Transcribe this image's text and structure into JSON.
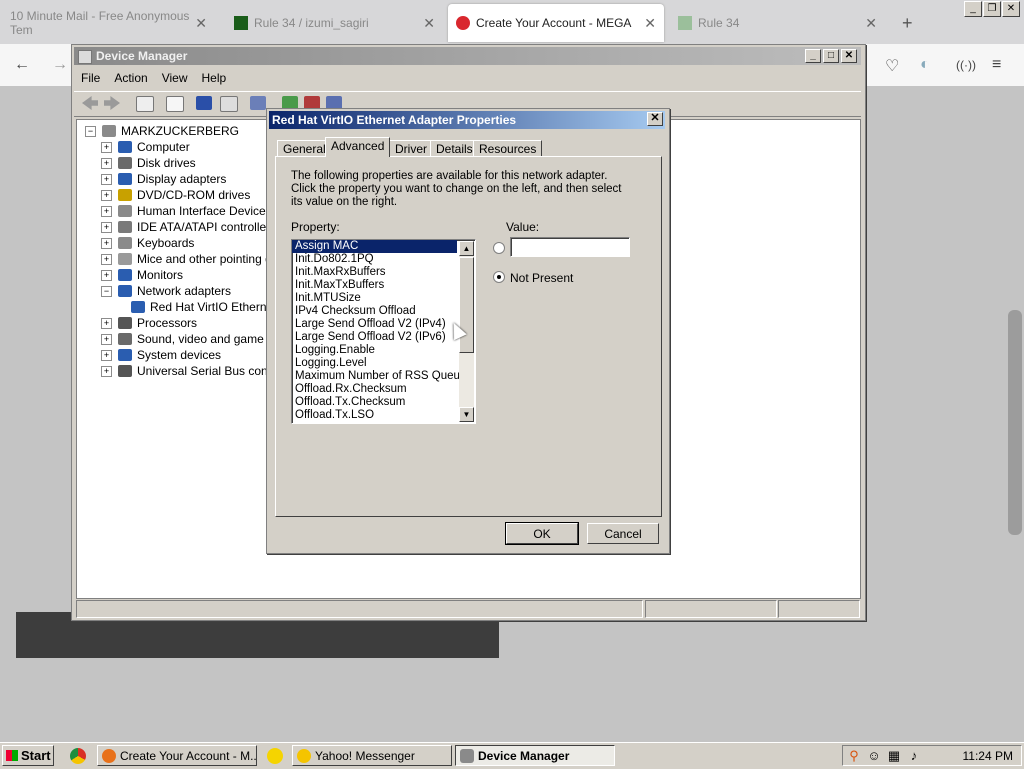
{
  "browser": {
    "tabs": [
      {
        "title": "10 Minute Mail - Free Anonymous Tem",
        "active": false
      },
      {
        "title": "Rule 34 / izumi_sagiri",
        "active": false
      },
      {
        "title": "Create Your Account - MEGA",
        "active": true
      },
      {
        "title": "Rule 34",
        "active": false
      }
    ],
    "new_tab": "+",
    "close_glyph": "✕"
  },
  "device_manager": {
    "title": "Device Manager",
    "menu": [
      "File",
      "Action",
      "View",
      "Help"
    ],
    "root": "MARKZUCKERBERG",
    "categories": [
      {
        "label": "Computer",
        "icon": "computer-icon",
        "color": "#2a5db0"
      },
      {
        "label": "Disk drives",
        "icon": "disk-icon",
        "color": "#6a6a6a"
      },
      {
        "label": "Display adapters",
        "icon": "display-icon",
        "color": "#2a5db0"
      },
      {
        "label": "DVD/CD-ROM drives",
        "icon": "dvd-icon",
        "color": "#c8a100"
      },
      {
        "label": "Human Interface Devices",
        "icon": "hid-icon",
        "color": "#8a8a8a"
      },
      {
        "label": "IDE ATA/ATAPI controllers",
        "icon": "ide-icon",
        "color": "#7a7a7a"
      },
      {
        "label": "Keyboards",
        "icon": "keyboard-icon",
        "color": "#8a8a8a"
      },
      {
        "label": "Mice and other pointing de",
        "icon": "mouse-icon",
        "color": "#9a9a9a"
      },
      {
        "label": "Monitors",
        "icon": "monitor-icon",
        "color": "#2a5db0"
      },
      {
        "label": "Network adapters",
        "icon": "network-icon",
        "color": "#2a5db0",
        "expanded": true
      },
      {
        "label": "Red Hat VirtIO Etherne",
        "icon": "adapter-icon",
        "color": "#2a5db0",
        "child": true
      },
      {
        "label": "Processors",
        "icon": "processor-icon",
        "color": "#555555"
      },
      {
        "label": "Sound, video and game co",
        "icon": "sound-icon",
        "color": "#6a6a6a"
      },
      {
        "label": "System devices",
        "icon": "system-icon",
        "color": "#2a5db0"
      },
      {
        "label": "Universal Serial Bus contro",
        "icon": "usb-icon",
        "color": "#555555"
      }
    ],
    "expand_glyph": "+",
    "collapse_glyph": "−"
  },
  "dialog": {
    "title": "Red Hat VirtIO Ethernet Adapter Properties",
    "tabs": [
      "General",
      "Advanced",
      "Driver",
      "Details",
      "Resources"
    ],
    "selected_tab": "Advanced",
    "description": "The following properties are available for this network adapter. Click the property you want to change on the left, and then select its value on the right.",
    "property_label": "Property:",
    "value_label": "Value:",
    "properties": [
      "Assign MAC",
      "Init.Do802.1PQ",
      "Init.MaxRxBuffers",
      "Init.MaxTxBuffers",
      "Init.MTUSize",
      "IPv4 Checksum Offload",
      "Large Send Offload V2 (IPv4)",
      "Large Send Offload V2 (IPv6)",
      "Logging.Enable",
      "Logging.Level",
      "Maximum Number of RSS Queues",
      "Offload.Rx.Checksum",
      "Offload.Tx.Checksum",
      "Offload.Tx.LSO"
    ],
    "selected_property": "Assign MAC",
    "value_input": "",
    "not_present_label": "Not Present",
    "not_present_selected": true,
    "ok_label": "OK",
    "cancel_label": "Cancel",
    "close_glyph": "✕"
  },
  "taskbar": {
    "start_label": "Start",
    "tasks": [
      {
        "label": "Create Your Account - M...",
        "icon_color": "#e8711a",
        "pressed": false
      },
      {
        "label": "Yahoo! Messenger",
        "icon_color": "#f5c400",
        "pressed": false
      },
      {
        "label": "Device Manager",
        "icon_color": "#7a7a7a",
        "pressed": true
      }
    ],
    "clock": "11:24 PM"
  }
}
